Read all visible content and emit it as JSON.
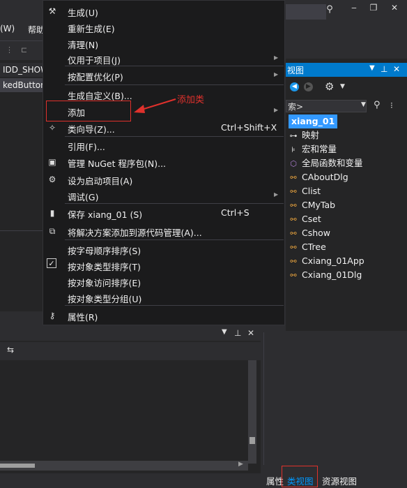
{
  "menubar": {
    "item_w": "(W)",
    "item_help": "帮助"
  },
  "editor": {
    "tab_idd": "IDD_SHOW",
    "tab_button": "kedButton"
  },
  "context_menu": {
    "items": [
      {
        "label": "生成(U)",
        "icon": "build-icon"
      },
      {
        "label": "重新生成(E)"
      },
      {
        "label": "清理(N)"
      },
      {
        "label": "仅用于项目(J)",
        "submenu": true
      },
      {
        "label": "按配置优化(P)",
        "submenu": true
      },
      {
        "label": "生成自定义(B)..."
      },
      {
        "label": "添加",
        "submenu": true
      },
      {
        "label": "类向导(Z)...",
        "shortcut": "Ctrl+Shift+X",
        "icon": "class-wizard-icon"
      },
      {
        "label": "引用(F)..."
      },
      {
        "label": "管理 NuGet 程序包(N)...",
        "icon": "nuget-icon"
      },
      {
        "label": "设为启动项目(A)",
        "icon": "gear-icon"
      },
      {
        "label": "调试(G)",
        "submenu": true
      },
      {
        "label": "保存 xiang_01 (S)",
        "shortcut": "Ctrl+S",
        "icon": "save-icon"
      },
      {
        "label": "将解决方案添加到源代码管理(A)...",
        "icon": "source-control-icon"
      },
      {
        "label": "按字母顺序排序(S)"
      },
      {
        "label": "按对象类型排序(T)",
        "checked": true
      },
      {
        "label": "按对象访问排序(E)"
      },
      {
        "label": "按对象类型分组(U)"
      },
      {
        "label": "属性(R)",
        "icon": "wrench-icon"
      }
    ]
  },
  "annotation": {
    "text": "添加类"
  },
  "class_view": {
    "title": "视图",
    "search_text": "索>",
    "root": "xiang_01",
    "tree": [
      {
        "label": "映射",
        "icon": "map-icon"
      },
      {
        "label": "宏和常量",
        "icon": "macro-icon"
      },
      {
        "label": "全局函数和变量",
        "icon": "global-icon"
      },
      {
        "label": "CAboutDlg",
        "icon": "class-icon"
      },
      {
        "label": "Clist",
        "icon": "class-icon"
      },
      {
        "label": "CMyTab",
        "icon": "class-icon"
      },
      {
        "label": "Cset",
        "icon": "class-icon"
      },
      {
        "label": "Cshow",
        "icon": "class-icon"
      },
      {
        "label": "CTree",
        "icon": "class-icon"
      },
      {
        "label": "Cxiang_01App",
        "icon": "class-icon"
      },
      {
        "label": "Cxiang_01Dlg",
        "icon": "class-icon"
      }
    ]
  },
  "bottom_tabs": {
    "properties": "属性",
    "class_view": "类视图",
    "resource_view": "资源视图"
  },
  "colors": {
    "accent": "#007acc",
    "highlight": "#e0312c",
    "menu_bg": "#1b1b1c"
  }
}
